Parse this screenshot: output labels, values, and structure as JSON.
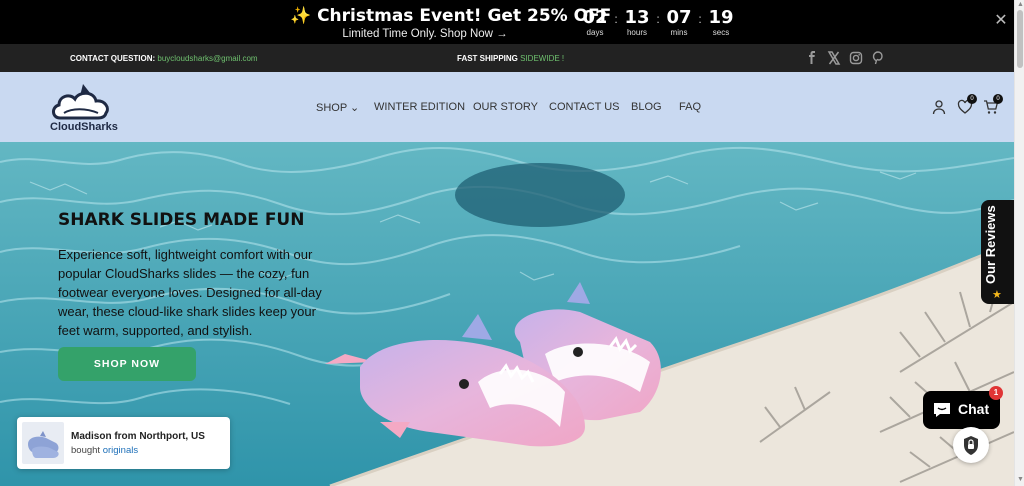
{
  "announcement": {
    "title": "✨ Christmas Event! Get 25% OFF",
    "subtitle": "Limited Time Only. Shop Now →",
    "countdown": [
      {
        "value": "02",
        "label": "days"
      },
      {
        "value": "13",
        "label": "hours"
      },
      {
        "value": "07",
        "label": "mins"
      },
      {
        "value": "19",
        "label": "secs"
      }
    ],
    "separator": ":",
    "close": "✕"
  },
  "infobar": {
    "contact_label": "CONTACT QUESTION: ",
    "contact_email": "buycloudsharks@gmail.com",
    "shipping_label": "FAST SHIPPING ",
    "shipping_highlight": "SIDEWIDE !",
    "social": [
      "facebook-icon",
      "x-icon",
      "instagram-icon",
      "pinterest-icon"
    ]
  },
  "header": {
    "logo_text": "CloudSharks",
    "nav": [
      {
        "label": "SHOP ⌄"
      },
      {
        "label": "WINTER EDITION"
      },
      {
        "label": "OUR STORY"
      },
      {
        "label": "CONTACT US"
      },
      {
        "label": "BLOG"
      },
      {
        "label": "FAQ"
      }
    ],
    "wishlist_count": "0",
    "cart_count": "0"
  },
  "hero": {
    "title": "SHARK SLIDES MADE FUN",
    "description": "Experience soft, lightweight comfort with our popular CloudSharks slides — the cozy, fun footwear everyone loves. Designed for all-day wear, these cloud-like shark slides keep your feet warm, supported, and stylish.",
    "cta": "SHOP NOW"
  },
  "reviews_tab": {
    "label": "Our Reviews",
    "star": "★"
  },
  "popup": {
    "name": "Madison from Northport, US",
    "bought_prefix": "bought ",
    "product": "originals"
  },
  "chat": {
    "label": "Chat",
    "badge": "1"
  },
  "colors": {
    "announcement_bg": "#000000",
    "infobar_bg": "#222222",
    "header_bg": "#c9d9f1",
    "accent_green": "#34a26a",
    "link_green": "#6fc16f"
  }
}
